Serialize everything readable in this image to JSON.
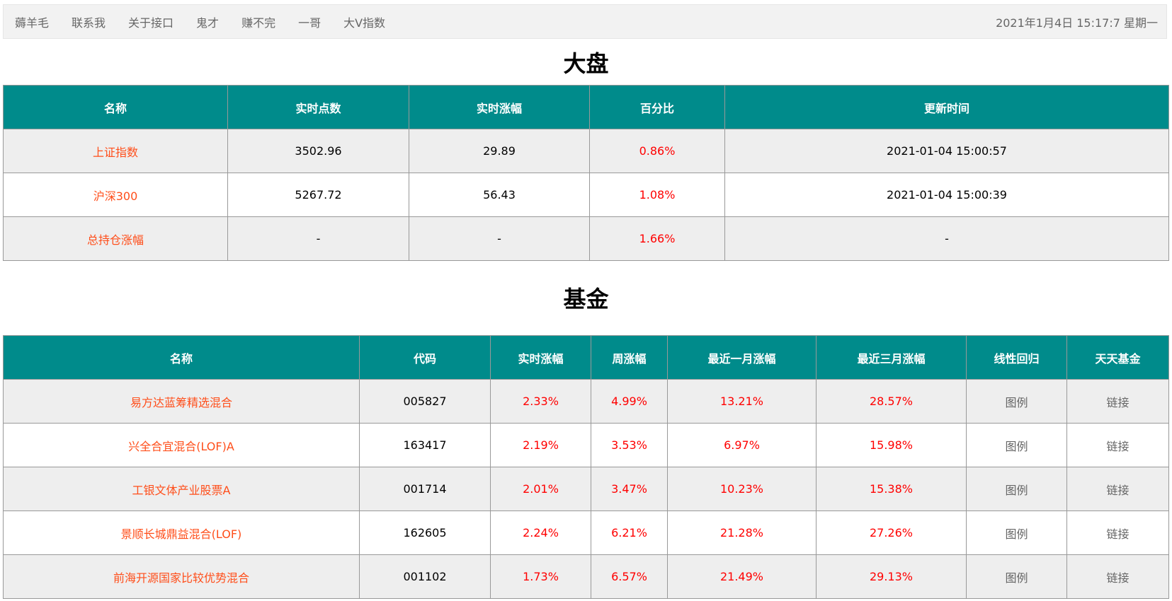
{
  "nav": {
    "links": [
      "薅羊毛",
      "联系我",
      "关于接口",
      "鬼才",
      "赚不完",
      "一哥",
      "大V指数"
    ],
    "clock": "2021年1月4日 15:17:7 星期一"
  },
  "market": {
    "title": "大盘",
    "headers": [
      "名称",
      "实时点数",
      "实时涨幅",
      "百分比",
      "更新时间"
    ],
    "rows": [
      {
        "name": "上证指数",
        "points": "3502.96",
        "change": "29.89",
        "percent": "0.86%",
        "updated": "2021-01-04 15:00:57"
      },
      {
        "name": "沪深300",
        "points": "5267.72",
        "change": "56.43",
        "percent": "1.08%",
        "updated": "2021-01-04 15:00:39"
      },
      {
        "name": "总持仓涨幅",
        "points": "-",
        "change": "-",
        "percent": "1.66%",
        "updated": "-"
      }
    ]
  },
  "funds": {
    "title": "基金",
    "headers": [
      "名称",
      "代码",
      "实时涨幅",
      "周涨幅",
      "最近一月涨幅",
      "最近三月涨幅",
      "线性回归",
      "天天基金"
    ],
    "rows": [
      {
        "name": "易方达蓝筹精选混合",
        "code": "005827",
        "realtime": "2.33%",
        "week": "4.99%",
        "month1": "13.21%",
        "month3": "28.57%",
        "chart": "图例",
        "link": "链接"
      },
      {
        "name": "兴全合宜混合(LOF)A",
        "code": "163417",
        "realtime": "2.19%",
        "week": "3.53%",
        "month1": "6.97%",
        "month3": "15.98%",
        "chart": "图例",
        "link": "链接"
      },
      {
        "name": "工银文体产业股票A",
        "code": "001714",
        "realtime": "2.01%",
        "week": "3.47%",
        "month1": "10.23%",
        "month3": "15.38%",
        "chart": "图例",
        "link": "链接"
      },
      {
        "name": "景顺长城鼎益混合(LOF)",
        "code": "162605",
        "realtime": "2.24%",
        "week": "6.21%",
        "month1": "21.28%",
        "month3": "27.26%",
        "chart": "图例",
        "link": "链接"
      },
      {
        "name": "前海开源国家比较优势混合",
        "code": "001102",
        "realtime": "1.73%",
        "week": "6.57%",
        "month1": "21.49%",
        "month3": "29.13%",
        "chart": "图例",
        "link": "链接"
      }
    ]
  },
  "colors": {
    "header_bg": "#008b8b",
    "name_link": "#ff4e1a",
    "positive": "#ff0000",
    "muted_link": "#666666"
  }
}
